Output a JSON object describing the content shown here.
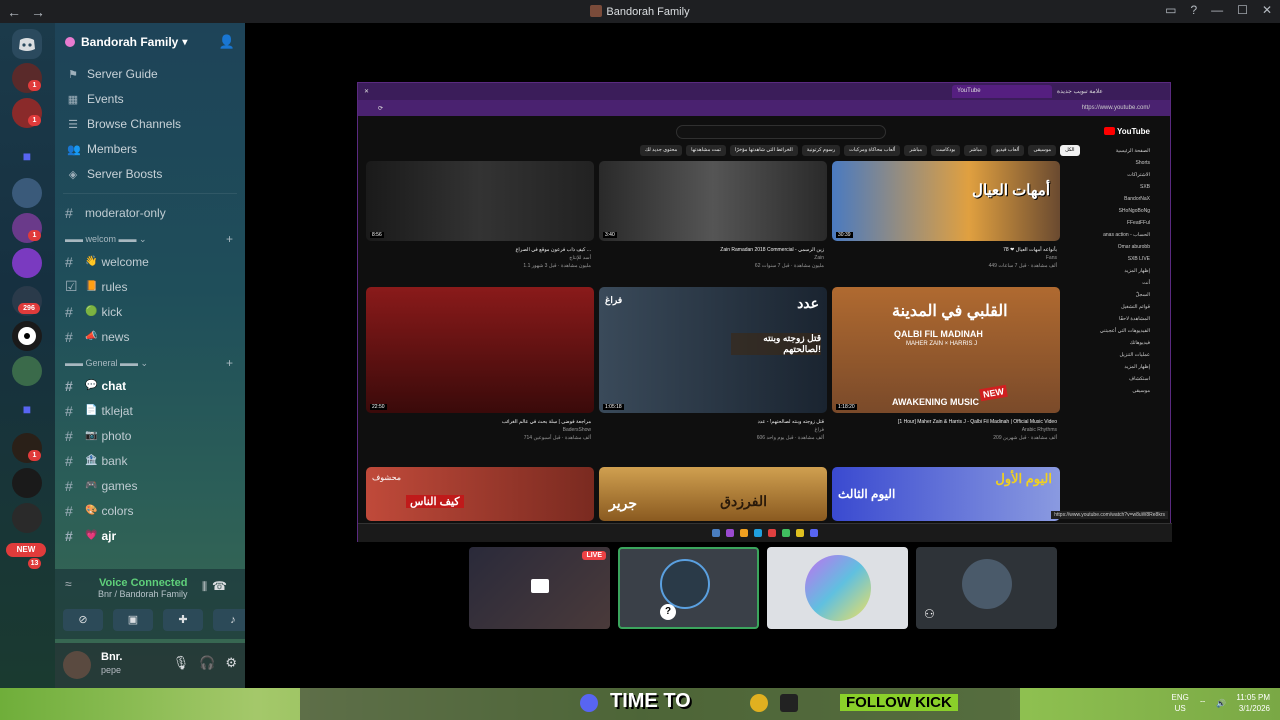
{
  "window": {
    "title": "Bandorah Family",
    "back": "←",
    "forward": "→"
  },
  "server": {
    "name": "Bandorah Family",
    "chevron": "⌄"
  },
  "menu": [
    {
      "label": "Server Guide",
      "icon": "guide-icon"
    },
    {
      "label": "Events",
      "icon": "calendar-icon"
    },
    {
      "label": "Browse Channels",
      "icon": "browse-icon"
    },
    {
      "label": "Members",
      "icon": "members-icon"
    },
    {
      "label": "Server Boosts",
      "icon": "boost-icon"
    }
  ],
  "top_channel": "moderator-only",
  "categories": {
    "welcom": "welcom",
    "general": "General"
  },
  "welcom_channels": [
    "welcome",
    "rules",
    "kick",
    "news"
  ],
  "general_channels": [
    "chat",
    "tklejat",
    "photo",
    "bank",
    "games",
    "colors",
    "ajr"
  ],
  "voice": {
    "status": "Voice Connected",
    "channel": "Bnr / Bandorah Family"
  },
  "user": {
    "name": "Bnr.",
    "status": "pepe"
  },
  "server_badges": [
    "1",
    "1",
    "1",
    "296",
    "1",
    "13"
  ],
  "new_badge": "NEW",
  "youtube": {
    "url": "https://www.youtube.com/",
    "tab_title": "YouTube",
    "tab2_title": "علامة تبويب جديدة",
    "logo": "YouTube",
    "chips": [
      "الكل",
      "موسيقى",
      "ألعاب فيديو",
      "مباشر",
      "بودكاست",
      "مباشر",
      "ألعاب محاكاة ومركبات",
      "رسوم كرتونية",
      "الخرائط التي شاهدتها مؤخرًا",
      "تمت مشاهدتها",
      "محتوى جديد لك"
    ],
    "sidebar": [
      "الصفحة الرئيسية",
      "Shorts",
      "الاشتراكات",
      "SXB",
      "BandorNaX",
      "SHoNgoBoNg",
      "FFeatFFul",
      "anas action - الحساب",
      "Omar aburobb",
      "SXB LIVE",
      "إظهار المزيد",
      "أنت",
      "السجلّ",
      "قوائم التشغيل",
      "المشاهدة لاحقًا",
      "الفيديوهات التي أعجبتني",
      "فيديوهاتك",
      "عمليات التنزيل",
      "إظهار المزيد",
      "استكشاف",
      "موسيقى"
    ],
    "status_url": "https://www.youtube.com/watch?v=w8uW8Re8krs",
    "videos": [
      {
        "title": "كيف ذاب فرعون موقع في الصراع ...",
        "channel": "أسد للإنتاج",
        "stats": "1.1 مليون مشاهدة · قبل 3 شهور",
        "duration": "8:56"
      },
      {
        "title": "Zain Ramadan 2018 Commercial - زين الرسمي",
        "channel": "Zain",
        "stats": "62 مليون مشاهدة · قبل 7 سنوات",
        "duration": "3:40"
      },
      {
        "title": "78 ❤ بأنواعه أمهات العيال",
        "channel": "Fans",
        "stats": "449 ألف مشاهدة · قبل 7 ساعات",
        "duration": "30:39"
      },
      {
        "title": "مراجعة فوضى | سلة بحث في عالم الغرائب",
        "channel": "BadersShow",
        "stats": "714 ألف مشاهدة · قبل أسبوعين",
        "duration": "22:50"
      },
      {
        "title": "قتل زوجته وبنته لصالحتهم! - عدد",
        "channel": "فراغ",
        "stats": "606 ألف مشاهدة · قبل يوم واحد",
        "duration": "1:05:18"
      },
      {
        "title": "[1 Hour] Maher Zain & Harris J - Qalbi Fil Madinah | Official Music Video",
        "channel": "Arabic Rhythms",
        "stats": "209 ألف مشاهدة · قبل شهرين",
        "duration": "1:18:20"
      }
    ],
    "thumb_texts": {
      "v3": "أمهات العيال",
      "v5a": "عدد",
      "v5b": "قتل زوجته وبنته لصالحتهم!",
      "v5c": "فراغ",
      "v6a": "القلبي في المدينة",
      "v6b": "QALBI FIL MADINAH",
      "v6c": "MAHER ZAIN × HARRIS J",
      "v6d": "AWAKENING MUSIC",
      "v6e": "NEW",
      "r1": "كيف الناس",
      "r1b": "محشوف",
      "r2": "جرير",
      "r2b": "الفرزدق",
      "r3": "اليوم الأول",
      "r3b": "اليوم الثالث"
    }
  },
  "stream_tiles": {
    "live": "LIVE"
  },
  "taskbar": {
    "lang1": "ENG",
    "lang2": "US",
    "time": "11:05 PM",
    "date": "3/1/2026",
    "game_text1": "TIME TO",
    "game_text2": "FOLLOW KICK"
  },
  "colors": {
    "live": "#ed4245",
    "voice_green": "#5fd07a",
    "youtube_red": "#ff0000",
    "selected_tile": "#3ba55d"
  }
}
